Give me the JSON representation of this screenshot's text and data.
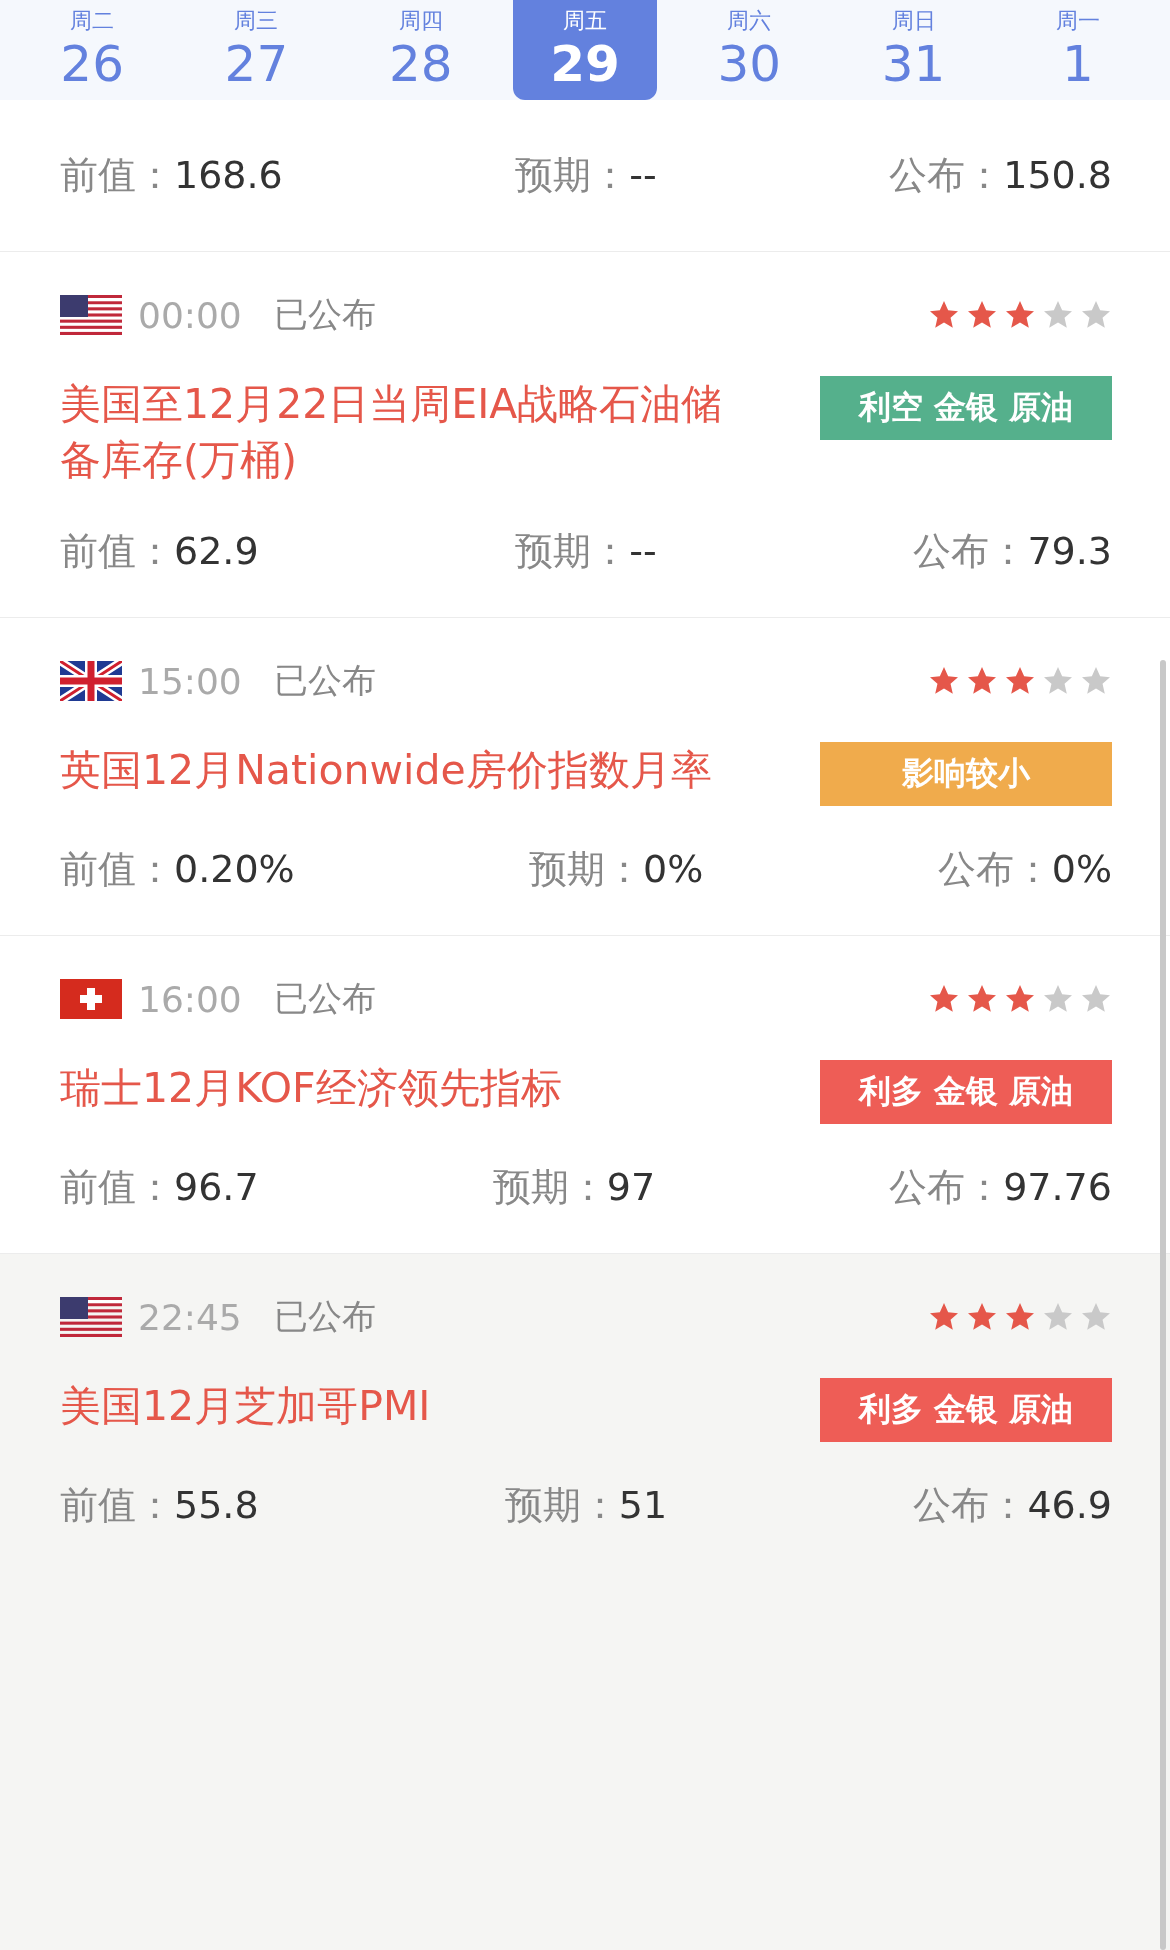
{
  "date_strip": [
    {
      "weekday": "周二",
      "day": "26",
      "selected": false
    },
    {
      "weekday": "周三",
      "day": "27",
      "selected": false
    },
    {
      "weekday": "周四",
      "day": "28",
      "selected": false
    },
    {
      "weekday": "周五",
      "day": "29",
      "selected": true
    },
    {
      "weekday": "周六",
      "day": "30",
      "selected": false
    },
    {
      "weekday": "周日",
      "day": "31",
      "selected": false
    },
    {
      "weekday": "周一",
      "day": "1",
      "selected": false
    }
  ],
  "events": [
    {
      "highlighted": false,
      "values": [
        {
          "label": "前值：",
          "value": "168.6"
        },
        {
          "label": "预期：",
          "value": "--"
        },
        {
          "label": "公布：",
          "value": "150.8"
        }
      ]
    },
    {
      "highlighted": false,
      "flag": {
        "kind": "us"
      },
      "time": "00:00",
      "status": "已公布",
      "stars": 3,
      "title": "美国至12月22日当周EIA战略石油储备库存(万桶)",
      "tag": {
        "kind": "bearish",
        "text": "利空 金银 原油"
      },
      "values": [
        {
          "label": "前值：",
          "value": "62.9"
        },
        {
          "label": "预期：",
          "value": "--"
        },
        {
          "label": "公布：",
          "value": "79.3"
        }
      ]
    },
    {
      "highlighted": false,
      "flag": {
        "kind": "uk"
      },
      "time": "15:00",
      "status": "已公布",
      "stars": 3,
      "title": "英国12月Nationwide房价指数月率",
      "tag": {
        "kind": "minor",
        "text": "影响较小"
      },
      "values": [
        {
          "label": "前值：",
          "value": "0.20%"
        },
        {
          "label": "预期：",
          "value": "0%"
        },
        {
          "label": "公布：",
          "value": "0%"
        }
      ]
    },
    {
      "highlighted": false,
      "flag": {
        "kind": "ch"
      },
      "time": "16:00",
      "status": "已公布",
      "stars": 3,
      "title": "瑞士12月KOF经济领先指标",
      "tag": {
        "kind": "bullish",
        "text": "利多 金银 原油"
      },
      "values": [
        {
          "label": "前值：",
          "value": "96.7"
        },
        {
          "label": "预期：",
          "value": "97"
        },
        {
          "label": "公布：",
          "value": "97.76"
        }
      ]
    },
    {
      "highlighted": true,
      "flag": {
        "kind": "us"
      },
      "time": "22:45",
      "status": "已公布",
      "stars": 3,
      "title": "美国12月芝加哥PMI",
      "tag": {
        "kind": "bullish",
        "text": "利多 金银 原油"
      },
      "values": [
        {
          "label": "前值：",
          "value": "55.8"
        },
        {
          "label": "预期：",
          "value": "51"
        },
        {
          "label": "公布：",
          "value": "46.9"
        }
      ]
    }
  ]
}
